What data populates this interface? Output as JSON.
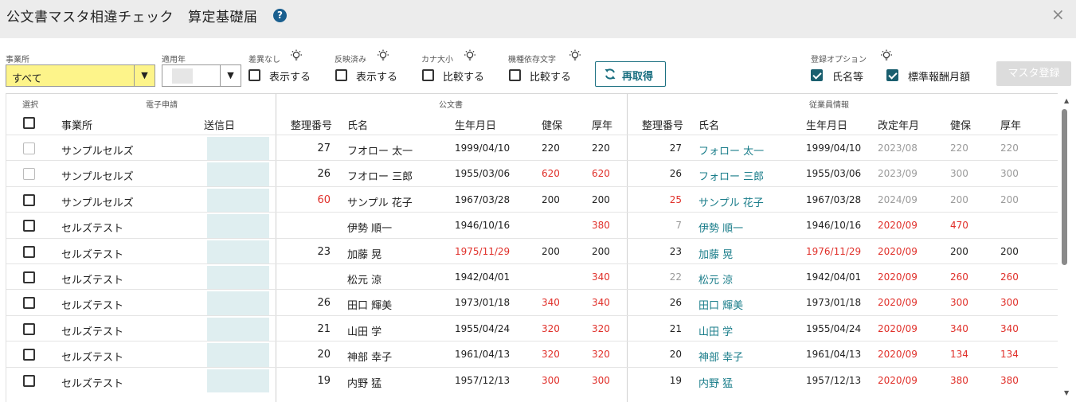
{
  "title": "公文書マスタ相違チェック",
  "subtitle": "算定基礎届",
  "help_label": "?",
  "close_label": "×",
  "filters": {
    "office_label": "事業所",
    "office_value": "すべて",
    "year_label": "適用年",
    "year_value": "",
    "diff_label": "差異なし",
    "diff_check": "表示する",
    "reflected_label": "反映済み",
    "reflected_check": "表示する",
    "kana_label": "カナ大小",
    "kana_check": "比較する",
    "model_label": "機種依存文字",
    "model_check": "比較する",
    "refetch_label": "再取得",
    "register_option_label": "登録オプション",
    "opt_name": "氏名等",
    "opt_salary": "標準報酬月額",
    "master_register_label": "マスタ登録"
  },
  "groups": {
    "select": "選択",
    "e_app": "電子申請",
    "official": "公文書",
    "employee": "従業員情報"
  },
  "headers": {
    "office": "事業所",
    "sent_date": "送信日",
    "o_no": "整理番号",
    "o_name": "氏名",
    "o_birth": "生年月日",
    "o_kenpo": "健保",
    "o_kounen": "厚年",
    "e_no": "整理番号",
    "e_name": "氏名",
    "e_birth": "生年月日",
    "e_revised": "改定年月",
    "e_kenpo": "健保",
    "e_kounen": "厚年"
  },
  "colors": {
    "red": "#e0302a",
    "teal": "#1a7d8a",
    "gray": "#9a9a9a",
    "accent": "#1a5f6f"
  },
  "rows": [
    {
      "office": "サンプルセルズ",
      "o_no": "27",
      "o_name": "フオロー 太一",
      "o_birth": "1999/04/10",
      "o_kenpo": "220",
      "o_kounen": "220",
      "e_no": "27",
      "e_name": "フォロー 太一",
      "e_birth": "1999/04/10",
      "e_revised": "2023/08",
      "e_kenpo": "220",
      "e_kounen": "220"
    },
    {
      "office": "サンプルセルズ",
      "o_no": "26",
      "o_name": "フオロー 三郎",
      "o_birth": "1955/03/06",
      "o_kenpo": "620",
      "o_kounen": "620",
      "e_no": "26",
      "e_name": "フォロー 三郎",
      "e_birth": "1955/03/06",
      "e_revised": "2023/09",
      "e_kenpo": "300",
      "e_kounen": "300"
    },
    {
      "office": "サンプルセルズ",
      "o_no": "60",
      "o_name": "サンプル 花子",
      "o_birth": "1967/03/28",
      "o_kenpo": "200",
      "o_kounen": "200",
      "e_no": "25",
      "e_name": "サンプル 花子",
      "e_birth": "1967/03/28",
      "e_revised": "2024/09",
      "e_kenpo": "200",
      "e_kounen": "200"
    },
    {
      "office": "セルズテスト",
      "o_no": "",
      "o_name": "伊勢 順一",
      "o_birth": "1946/10/16",
      "o_kenpo": "",
      "o_kounen": "380",
      "e_no": "7",
      "e_name": "伊勢 順一",
      "e_birth": "1946/10/16",
      "e_revised": "2020/09",
      "e_kenpo": "470",
      "e_kounen": ""
    },
    {
      "office": "セルズテスト",
      "o_no": "23",
      "o_name": "加藤 晃",
      "o_birth": "1975/11/29",
      "o_kenpo": "200",
      "o_kounen": "200",
      "e_no": "23",
      "e_name": "加藤 晃",
      "e_birth": "1976/11/29",
      "e_revised": "2020/09",
      "e_kenpo": "200",
      "e_kounen": "200"
    },
    {
      "office": "セルズテスト",
      "o_no": "",
      "o_name": "松元 涼",
      "o_birth": "1942/04/01",
      "o_kenpo": "",
      "o_kounen": "340",
      "e_no": "22",
      "e_name": "松元 涼",
      "e_birth": "1942/04/01",
      "e_revised": "2020/09",
      "e_kenpo": "260",
      "e_kounen": "260"
    },
    {
      "office": "セルズテスト",
      "o_no": "26",
      "o_name": "田口 輝美",
      "o_birth": "1973/01/18",
      "o_kenpo": "340",
      "o_kounen": "340",
      "e_no": "26",
      "e_name": "田口 輝美",
      "e_birth": "1973/01/18",
      "e_revised": "2020/09",
      "e_kenpo": "300",
      "e_kounen": "300"
    },
    {
      "office": "セルズテスト",
      "o_no": "21",
      "o_name": "山田 学",
      "o_birth": "1955/04/24",
      "o_kenpo": "320",
      "o_kounen": "320",
      "e_no": "21",
      "e_name": "山田 学",
      "e_birth": "1955/04/24",
      "e_revised": "2020/09",
      "e_kenpo": "340",
      "e_kounen": "340"
    },
    {
      "office": "セルズテスト",
      "o_no": "20",
      "o_name": "神部 幸子",
      "o_birth": "1961/04/13",
      "o_kenpo": "320",
      "o_kounen": "320",
      "e_no": "20",
      "e_name": "神部 幸子",
      "e_birth": "1961/04/13",
      "e_revised": "2020/09",
      "e_kenpo": "134",
      "e_kounen": "134"
    },
    {
      "office": "セルズテスト",
      "o_no": "19",
      "o_name": "内野 猛",
      "o_birth": "1957/12/13",
      "o_kenpo": "300",
      "o_kounen": "300",
      "e_no": "19",
      "e_name": "内野 猛",
      "e_birth": "1957/12/13",
      "e_revised": "2020/09",
      "e_kenpo": "380",
      "e_kounen": "380"
    }
  ]
}
